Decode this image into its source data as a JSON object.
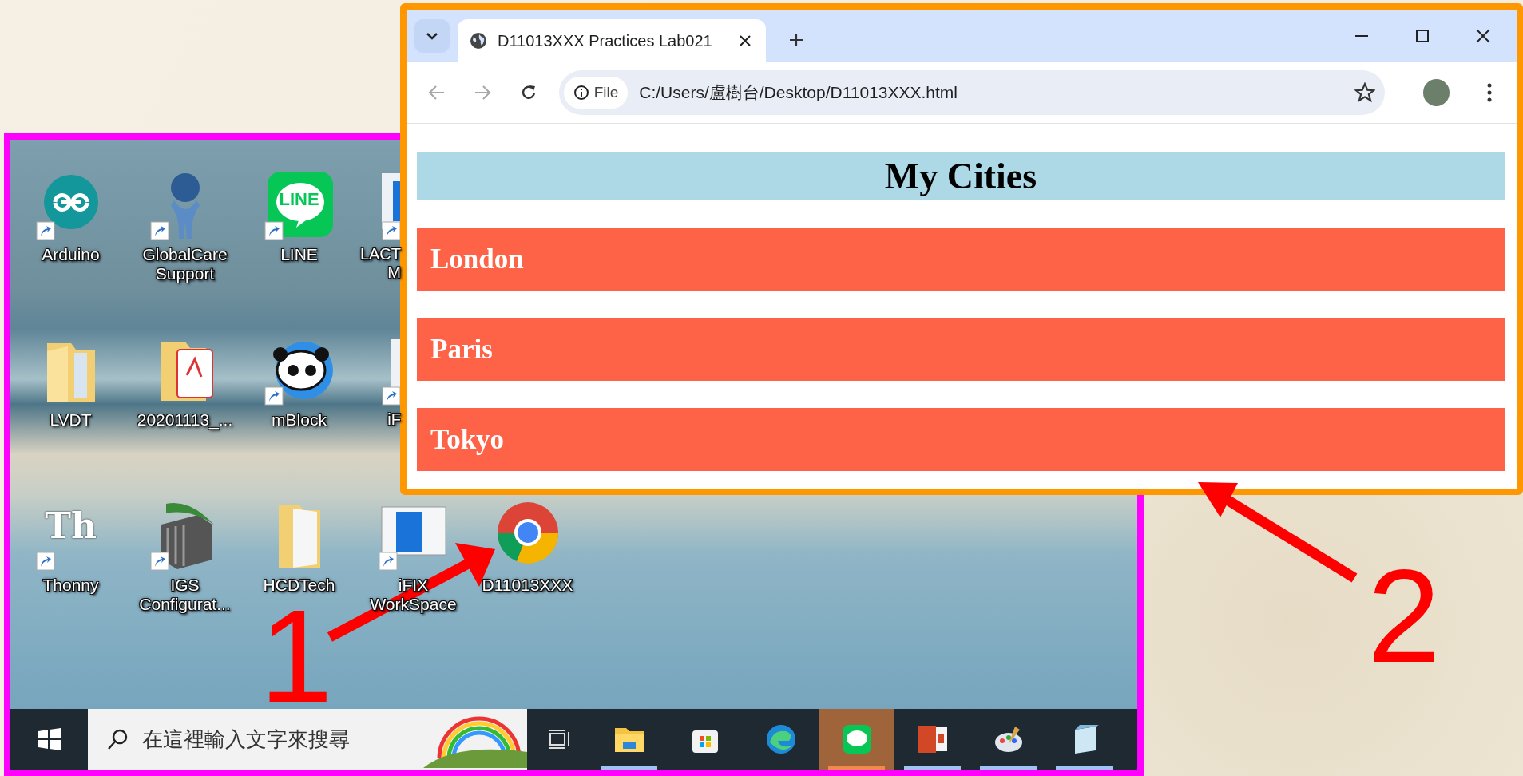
{
  "desktop": {
    "icon_rows": [
      [
        {
          "kind": "full",
          "label": "Arduino",
          "shortcut": true
        },
        {
          "kind": "full",
          "label": "GlobalCare Support",
          "shortcut": true
        },
        {
          "kind": "full",
          "label": "LINE",
          "shortcut": true,
          "logo_text": "LINE"
        },
        {
          "kind": "partial",
          "label": "LACT M",
          "shortcut": true
        }
      ],
      [
        {
          "kind": "full",
          "label": "LVDT",
          "shortcut": false
        },
        {
          "kind": "full",
          "label": "20201113_...",
          "shortcut": false
        },
        {
          "kind": "full",
          "label": "mBlock",
          "shortcut": true
        },
        {
          "kind": "partial",
          "label": "iF",
          "shortcut": true
        }
      ],
      [
        {
          "kind": "full",
          "label": "Thonny",
          "shortcut": true,
          "logo_text": "Th"
        },
        {
          "kind": "full",
          "label": "IGS Configurat...",
          "shortcut": true
        },
        {
          "kind": "full",
          "label": "HCDTech",
          "shortcut": false
        },
        {
          "kind": "full",
          "label": "iFIX WorkSpace",
          "shortcut": true
        },
        {
          "kind": "full",
          "label": "D11013XXX",
          "shortcut": false
        }
      ]
    ]
  },
  "taskbar": {
    "search": {
      "placeholder": "在這裡輸入文字來搜尋"
    },
    "apps": [
      {
        "kind": "taskview",
        "running": false,
        "selected": false
      },
      {
        "kind": "app",
        "running": true,
        "selected": false
      },
      {
        "kind": "app",
        "running": false,
        "selected": false
      },
      {
        "kind": "app",
        "running": false,
        "selected": false
      },
      {
        "kind": "app",
        "running": true,
        "selected": true
      },
      {
        "kind": "app",
        "running": true,
        "selected": false
      },
      {
        "kind": "app",
        "running": true,
        "selected": false
      },
      {
        "kind": "app",
        "running": true,
        "selected": false
      }
    ]
  },
  "browser": {
    "tab": {
      "title": "D11013XXX Practices Lab021"
    },
    "nav": {
      "back_disabled": true,
      "forward_disabled": true
    },
    "address": {
      "chip": "File",
      "url": "C:/Users/盧樹台/Desktop/D11013XXX.html"
    },
    "page": {
      "heading": "My Cities",
      "cities": [
        "London",
        "Paris",
        "Tokyo"
      ]
    }
  },
  "annotations": [
    {
      "label": "1"
    },
    {
      "label": "2"
    }
  ]
}
